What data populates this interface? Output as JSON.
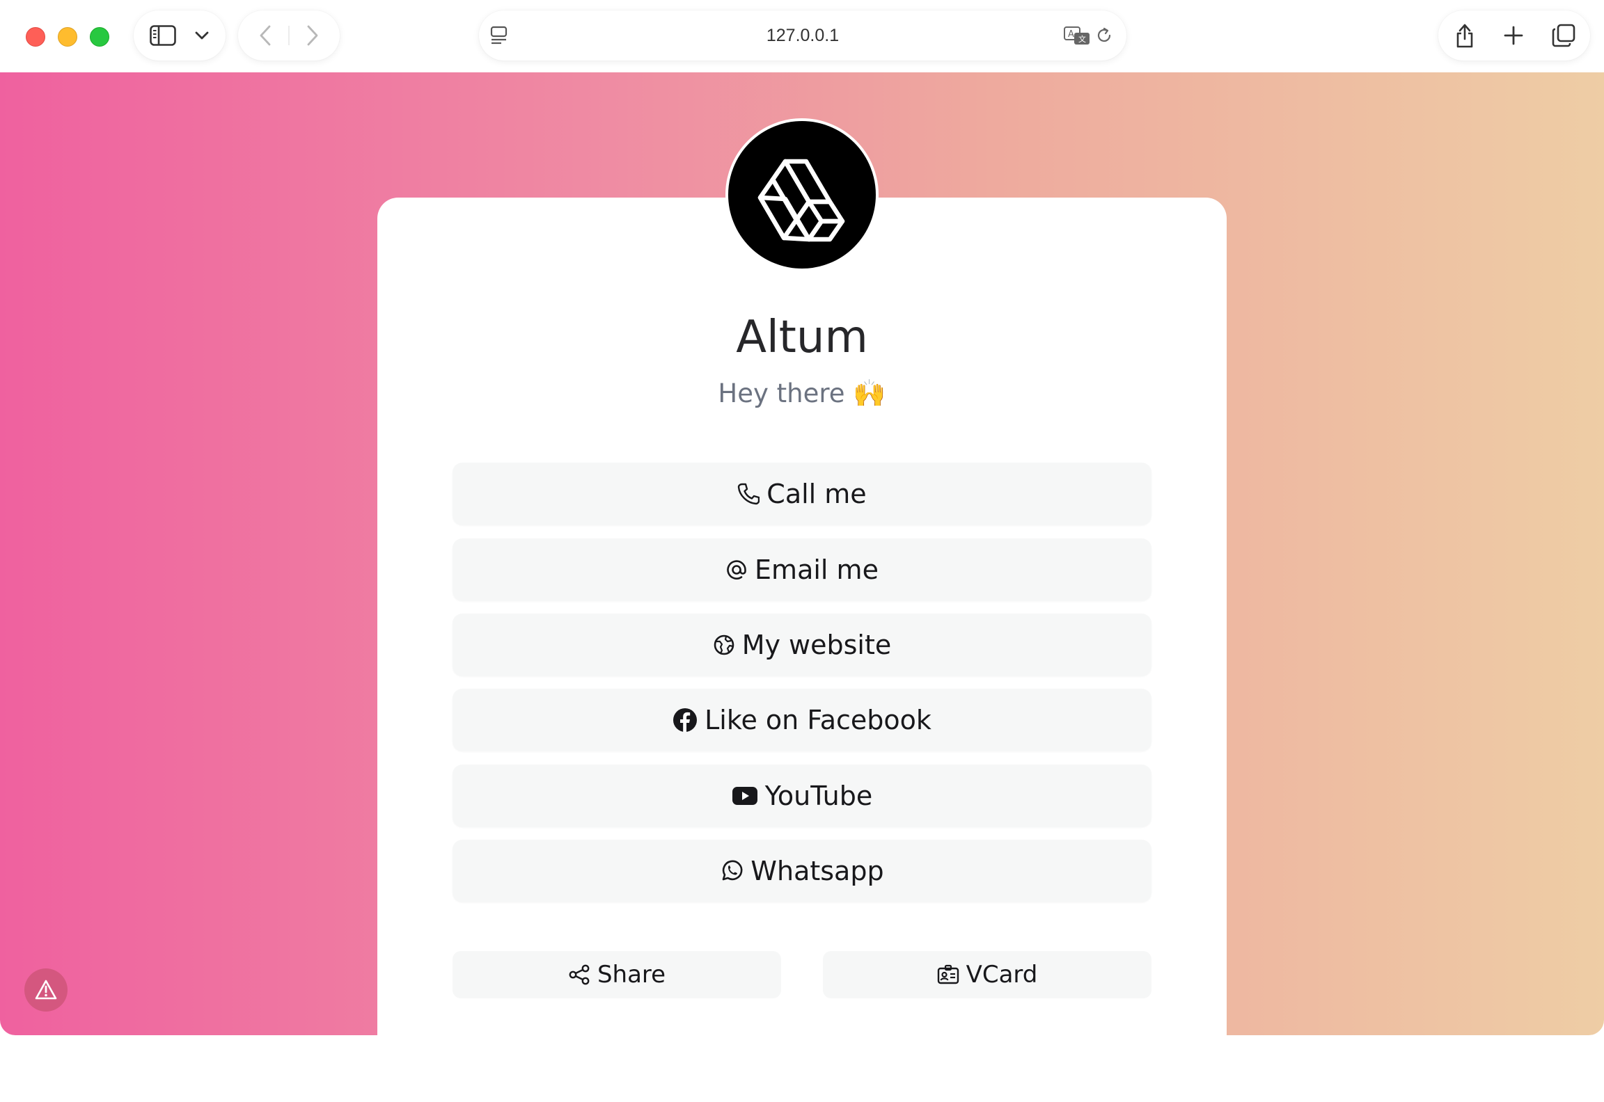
{
  "browser": {
    "url": "127.0.0.1"
  },
  "profile": {
    "name": "Altum",
    "tagline": "Hey there",
    "tagline_emoji": "🙌"
  },
  "links": [
    {
      "label": "Call me",
      "icon": "phone-icon"
    },
    {
      "label": "Email me",
      "icon": "at-icon"
    },
    {
      "label": "My website",
      "icon": "globe-icon"
    },
    {
      "label": "Like on Facebook",
      "icon": "facebook-icon"
    },
    {
      "label": "YouTube",
      "icon": "youtube-icon"
    },
    {
      "label": "Whatsapp",
      "icon": "whatsapp-icon"
    }
  ],
  "actions": {
    "share_label": "Share",
    "vcard_label": "VCard"
  },
  "colors": {
    "gradient_start": "#ef619f",
    "gradient_end": "#eecda5",
    "button_bg": "#f6f7f7"
  }
}
